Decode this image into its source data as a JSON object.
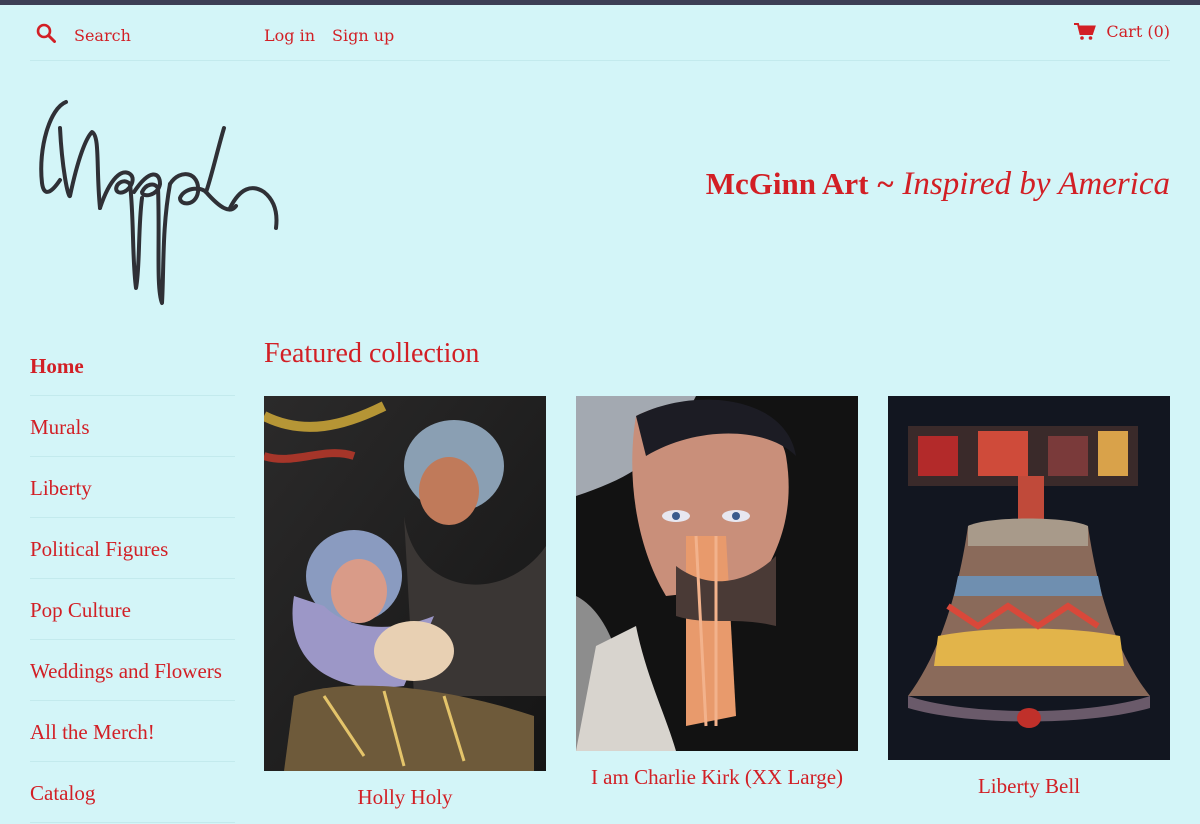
{
  "header": {
    "search_placeholder": "Search",
    "login_label": "Log in",
    "signup_label": "Sign up",
    "cart_label": "Cart (0)"
  },
  "brand": {
    "logo_signature": "McGinn",
    "name": "McGinn Art",
    "separator": "~",
    "tagline": "Inspired by America"
  },
  "sidebar": {
    "items": [
      {
        "label": "Home"
      },
      {
        "label": "Murals"
      },
      {
        "label": "Liberty"
      },
      {
        "label": "Political Figures"
      },
      {
        "label": "Pop Culture"
      },
      {
        "label": "Weddings and Flowers"
      },
      {
        "label": "All the Merch!"
      },
      {
        "label": "Catalog"
      }
    ]
  },
  "featured": {
    "title": "Featured collection",
    "products": [
      {
        "title": "Holly Holy"
      },
      {
        "title": "I am Charlie Kirk (XX Large)"
      },
      {
        "title": "Liberty Bell"
      }
    ]
  },
  "colors": {
    "background": "#d3f5f8",
    "accent": "#d21f25",
    "topbar": "#3c3f55"
  }
}
